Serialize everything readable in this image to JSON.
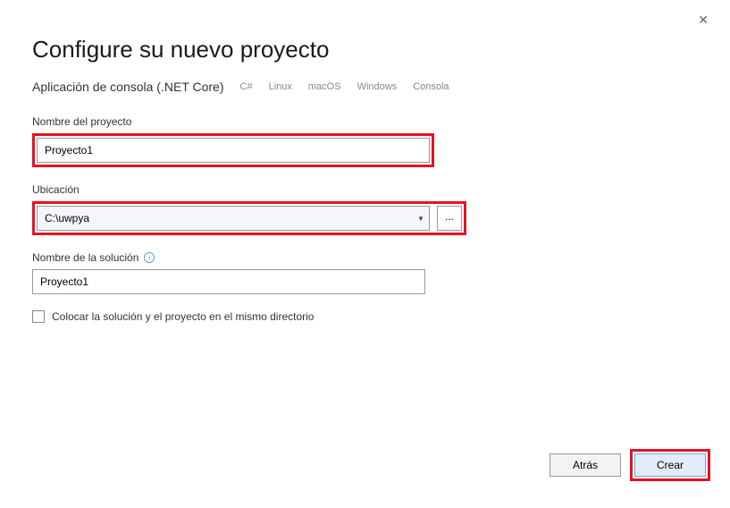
{
  "close": "✕",
  "title": "Configure su nuevo proyecto",
  "subtitle": "Aplicación de consola (.NET Core)",
  "tags": [
    "C#",
    "Linux",
    "macOS",
    "Windows",
    "Consola"
  ],
  "fields": {
    "projectName": {
      "label": "Nombre del proyecto",
      "value": "Proyecto1"
    },
    "location": {
      "label": "Ubicación",
      "value": "C:\\uwpya",
      "browse": "..."
    },
    "solutionName": {
      "label": "Nombre de la solución",
      "value": "Proyecto1"
    }
  },
  "checkbox": {
    "label": "Colocar la solución y el proyecto en el mismo directorio",
    "checked": false
  },
  "buttons": {
    "back": "Atrás",
    "create": "Crear"
  }
}
